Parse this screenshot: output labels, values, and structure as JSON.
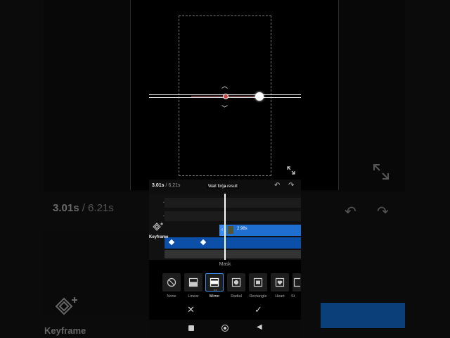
{
  "editor": {
    "current_time": "3.01s",
    "duration": "/ 6.21s",
    "wait_message": "Wait for a result",
    "clip_duration": "2.98s",
    "keyframe_label": "Keyframe"
  },
  "mask_panel": {
    "title": "Mask",
    "options": [
      "None",
      "Linear",
      "Mirror",
      "Radial",
      "Rectangle",
      "Heart",
      "St"
    ],
    "selected": "Mirror"
  },
  "background": {
    "current_time": "3.01s",
    "duration": "/ 6.21s",
    "keyframe_label": "Keyframe"
  },
  "icons": {
    "undo": "undo-icon",
    "redo": "redo-icon",
    "play": "play-icon",
    "expand": "expand-icon",
    "keyframe": "keyframe-add-icon",
    "cancel": "close-icon",
    "confirm": "check-icon"
  },
  "colors": {
    "accent": "#1f6fd1",
    "selection": "#3a8ef0",
    "logo": "#b3262c"
  }
}
